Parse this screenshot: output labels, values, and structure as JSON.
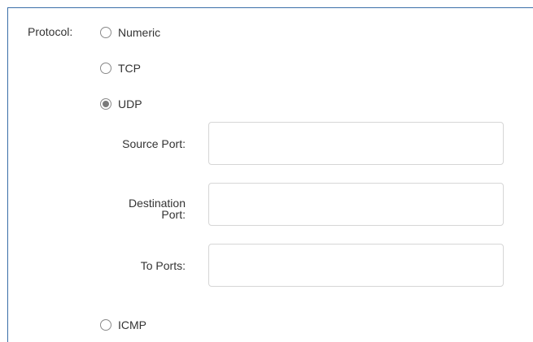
{
  "form": {
    "protocol_label": "Protocol:",
    "options": [
      {
        "label": "Numeric",
        "checked": false
      },
      {
        "label": "TCP",
        "checked": false
      },
      {
        "label": "UDP",
        "checked": true
      },
      {
        "label": "ICMP",
        "checked": false
      }
    ],
    "udp_fields": {
      "source_port_label": "Source Port:",
      "source_port_value": "",
      "destination_port_label_line1": "Destination",
      "destination_port_label_line2": "Port:",
      "destination_port_value": "",
      "to_ports_label": "To Ports:",
      "to_ports_value": ""
    }
  },
  "colors": {
    "frame_border": "#3a6fa8",
    "input_border": "#d6d6d6",
    "text": "#333333"
  }
}
